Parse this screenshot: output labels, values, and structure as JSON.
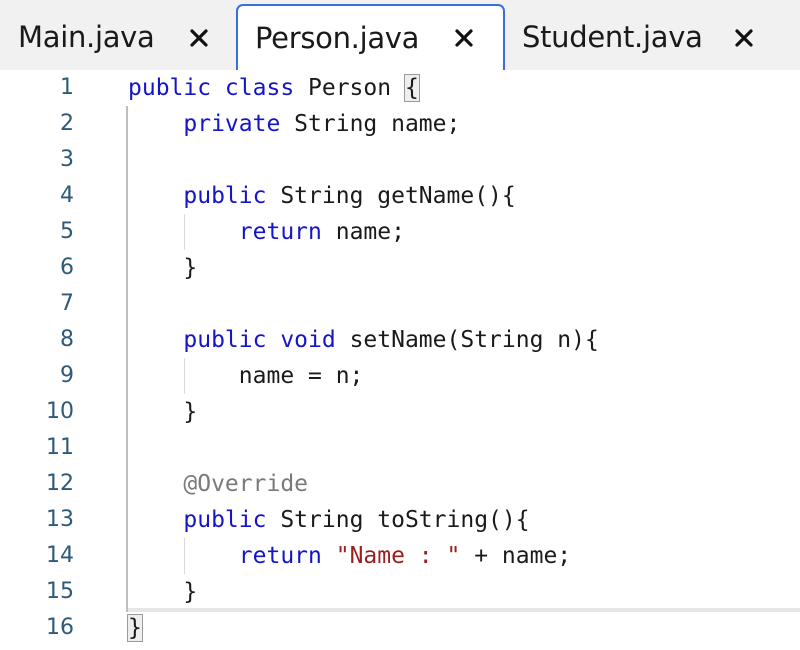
{
  "tabs": [
    {
      "label": "Main.java",
      "active": false
    },
    {
      "label": "Person.java",
      "active": true
    },
    {
      "label": "Student.java",
      "active": false
    }
  ],
  "editor": {
    "lines": [
      {
        "num": "1",
        "tokens": [
          {
            "t": "public class",
            "c": "kw"
          },
          {
            "t": " Person ",
            "c": ""
          },
          {
            "t": "{",
            "c": "brace-hl"
          }
        ]
      },
      {
        "num": "2",
        "tokens": [
          {
            "t": "    private",
            "c": "kw"
          },
          {
            "t": " String name;",
            "c": ""
          }
        ]
      },
      {
        "num": "3",
        "tokens": []
      },
      {
        "num": "4",
        "tokens": [
          {
            "t": "    public",
            "c": "kw"
          },
          {
            "t": " String getName(){",
            "c": ""
          }
        ]
      },
      {
        "num": "5",
        "tokens": [
          {
            "t": "        return",
            "c": "kw"
          },
          {
            "t": " name;",
            "c": ""
          }
        ]
      },
      {
        "num": "6",
        "tokens": [
          {
            "t": "    }",
            "c": ""
          }
        ]
      },
      {
        "num": "7",
        "tokens": []
      },
      {
        "num": "8",
        "tokens": [
          {
            "t": "    public void",
            "c": "kw"
          },
          {
            "t": " setName(String n){",
            "c": ""
          }
        ]
      },
      {
        "num": "9",
        "tokens": [
          {
            "t": "        name = n;",
            "c": ""
          }
        ]
      },
      {
        "num": "10",
        "tokens": [
          {
            "t": "    }",
            "c": ""
          }
        ]
      },
      {
        "num": "11",
        "tokens": []
      },
      {
        "num": "12",
        "tokens": [
          {
            "t": "    @Override",
            "c": "ann"
          }
        ]
      },
      {
        "num": "13",
        "tokens": [
          {
            "t": "    public",
            "c": "kw"
          },
          {
            "t": " String toString(){",
            "c": ""
          }
        ]
      },
      {
        "num": "14",
        "tokens": [
          {
            "t": "        return",
            "c": "kw"
          },
          {
            "t": " \"Name : \"",
            "c": "str"
          },
          {
            "t": " + name;",
            "c": ""
          }
        ]
      },
      {
        "num": "15",
        "tokens": [
          {
            "t": "    }",
            "c": ""
          }
        ]
      },
      {
        "num": "16",
        "tokens": [
          {
            "t": "}",
            "c": "brace-hl"
          }
        ]
      }
    ]
  },
  "colors": {
    "keyword": "#1515c8",
    "string": "#9a1f1f",
    "annotation": "#7a7a7a",
    "line_number": "#2e5a7a",
    "active_tab_border": "#3a6fd8"
  },
  "icons": {
    "close": "close-icon"
  }
}
